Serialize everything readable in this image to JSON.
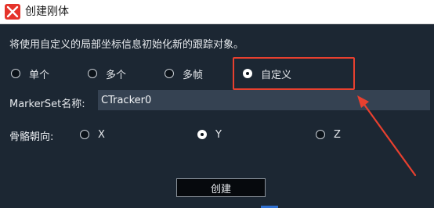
{
  "window": {
    "title": "创建刚体",
    "icon": "app-logo-icon"
  },
  "description": "将使用自定义的局部坐标信息初始化新的跟踪对象。",
  "init_options": [
    {
      "label": "单个",
      "checked": false
    },
    {
      "label": "多个",
      "checked": false
    },
    {
      "label": "多帧",
      "checked": false
    },
    {
      "label": "自定义",
      "checked": true
    }
  ],
  "markerset": {
    "label": "MarkerSet名称:",
    "value": "CTracker0"
  },
  "bone_axis": {
    "label": "骨骼朝向:",
    "options": [
      {
        "label": "X",
        "checked": false
      },
      {
        "label": "Y",
        "checked": true
      },
      {
        "label": "Z",
        "checked": false
      }
    ]
  },
  "actions": {
    "create_label": "创建"
  },
  "colors": {
    "panel_bg": "#1c2733",
    "input_bg": "#354252",
    "annotation_red": "#e8402f",
    "accent_blue": "#2f6fd0"
  }
}
